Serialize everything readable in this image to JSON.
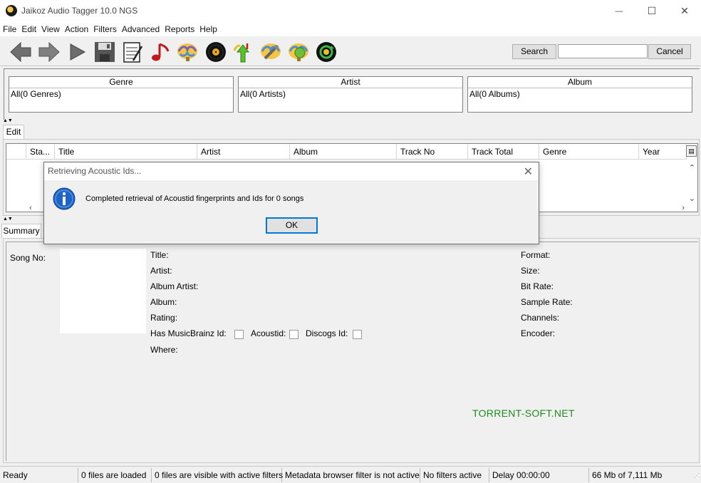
{
  "window": {
    "title": "Jaikoz Audio Tagger 10.0 NGS",
    "minimize_glyph": "—",
    "maximize_glyph": "☐",
    "close_glyph": "✕"
  },
  "menu": [
    "File",
    "Edit",
    "View",
    "Action",
    "Filters",
    "Advanced",
    "Reports",
    "Help"
  ],
  "toolbar": {
    "icons": [
      "back-arrow-icon",
      "forward-arrow-icon",
      "play-icon",
      "save-icon",
      "notepad-icon",
      "music-note-icon",
      "brain-icon",
      "vinyl-record-icon",
      "upload-arrows-icon",
      "brain-wrench-icon",
      "brain-globe-icon",
      "vinyl-cycle-icon"
    ],
    "search_label": "Search",
    "search_value": "",
    "cancel_label": "Cancel"
  },
  "browser": {
    "genre": {
      "header": "Genre",
      "value": "All(0 Genres)"
    },
    "artist": {
      "header": "Artist",
      "value": "All(0 Artists)"
    },
    "album": {
      "header": "Album",
      "value": "All(0 Albums)"
    }
  },
  "edit_tab": "Edit",
  "table": {
    "columns": [
      "Sta...",
      "Title",
      "Artist",
      "Album",
      "Track No",
      "Track Total",
      "Genre",
      "Year"
    ],
    "rows": []
  },
  "summary": {
    "tab": "Summary",
    "song_no_label": "Song No:",
    "left_labels": {
      "title": "Title:",
      "artist": "Artist:",
      "album_artist": "Album Artist:",
      "album": "Album:",
      "rating": "Rating:",
      "has_mb": "Has MusicBrainz Id:",
      "acoustid": "Acoustid:",
      "discogs": "Discogs Id:",
      "where": "Where:"
    },
    "right_labels": {
      "format": "Format:",
      "size": "Size:",
      "bit_rate": "Bit Rate:",
      "sample_rate": "Sample Rate:",
      "channels": "Channels:",
      "encoder": "Encoder:"
    },
    "watermark": "TORRENT-SOFT.NET"
  },
  "dialog": {
    "title": "Retrieving Acoustic Ids...",
    "message": "Completed retrieval of Acoustid fingerprints and Ids for 0 songs",
    "ok_label": "OK"
  },
  "status": {
    "ready": "Ready",
    "files_loaded": "0 files are loaded",
    "files_visible": "0 files are visible with active filters",
    "metadata_filter": "Metadata browser filter is not active",
    "filters": "No filters active",
    "delay": "Delay 00:00:00",
    "memory": "66 Mb of 7,111 Mb"
  },
  "colors": {
    "info_blue": "#1e64c8",
    "focus_blue": "#0078d7",
    "watermark_green": "#1e8a1e"
  }
}
